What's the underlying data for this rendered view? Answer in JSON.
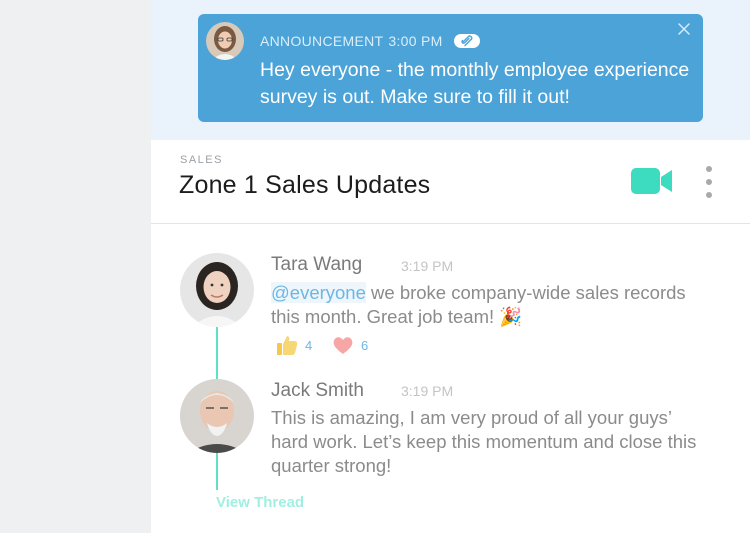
{
  "announcement": {
    "label": "ANNOUNCEMENT",
    "time": "3:00 PM",
    "text": "Hey everyone - the monthly employee experience survey is out. Make sure to fill it out!",
    "attachment_icon": "paperclip-icon",
    "close_icon": "close-icon"
  },
  "channel": {
    "eyebrow": "SALES",
    "title": "Zone 1 Sales Updates",
    "video_icon": "video-camera-icon",
    "menu_icon": "kebab-menu-icon"
  },
  "messages": [
    {
      "name": "Tara Wang",
      "time": "3:19 PM",
      "mention": "@everyone",
      "text": " we broke company-wide sales records this month. Great job team! 🎉",
      "reactions": [
        {
          "icon": "thumbs-up-icon",
          "count": "4"
        },
        {
          "icon": "heart-icon",
          "count": "6"
        }
      ]
    },
    {
      "name": "Jack Smith",
      "time": "3:19 PM",
      "text": "This is amazing, I am very proud of all your guys’ hard work. Let’s keep this momentum and close this quarter strong!"
    }
  ],
  "thread": {
    "link": "View Thread"
  },
  "colors": {
    "announcement_bg": "#4ba3d8",
    "accent_teal": "#3ddbc0",
    "mention_blue": "#6bb7e3"
  }
}
